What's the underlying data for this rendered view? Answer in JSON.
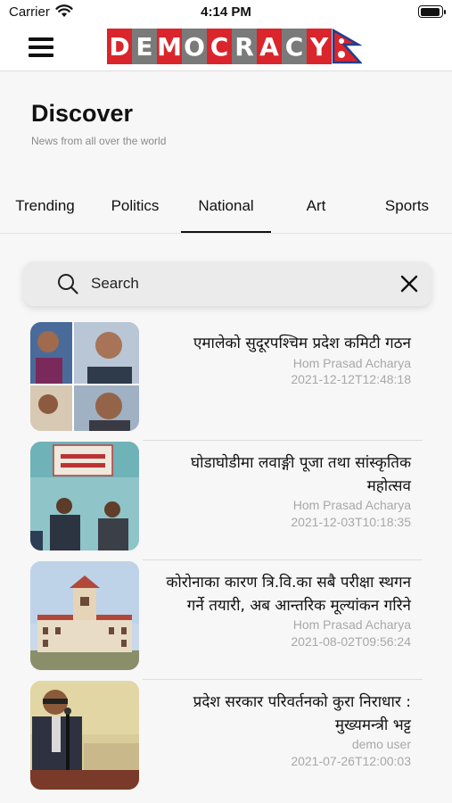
{
  "status_bar": {
    "carrier": "Carrier",
    "time": "4:14 PM",
    "wifi_icon": "wifi-icon",
    "battery_icon": "battery-icon"
  },
  "nav": {
    "menu_icon": "hamburger-menu-icon",
    "logo_text": "DEMOCRACY",
    "logo_colors": {
      "red": "#d9252b",
      "grey": "#7a7a7a",
      "flag_blue": "#1f3f8f"
    }
  },
  "header": {
    "title": "Discover",
    "subtitle": "News from all over the world"
  },
  "tabs": [
    {
      "label": "Trending",
      "active": false
    },
    {
      "label": "Politics",
      "active": false
    },
    {
      "label": "National",
      "active": true
    },
    {
      "label": "Art",
      "active": false
    },
    {
      "label": "Sports",
      "active": false
    }
  ],
  "search": {
    "placeholder": "Search",
    "search_icon": "search-icon",
    "clear_icon": "close-icon"
  },
  "news": [
    {
      "title": "एमालेको सुदूरपश्चिम प्रदेश कमिटी गठन",
      "author": "Hom Prasad Acharya",
      "date": "2021-12-12T12:48:18"
    },
    {
      "title": "घोडाघोडीमा लवाङ्गी पूजा तथा सांस्कृतिक महोत्सव",
      "author": "Hom Prasad Acharya",
      "date": "2021-12-03T10:18:35"
    },
    {
      "title": "कोरोनाका कारण त्रि.वि.का सबै परीक्षा स्थगन गर्ने तयारी, अब आन्तरिक मूल्यांकन गरिने",
      "author": "Hom Prasad Acharya",
      "date": "2021-08-02T09:56:24"
    },
    {
      "title": "प्रदेश सरकार परिवर्तनको कुरा निराधार : मुख्यमन्त्री भट्ट",
      "author": "demo user",
      "date": "2021-07-26T12:00:03"
    }
  ]
}
